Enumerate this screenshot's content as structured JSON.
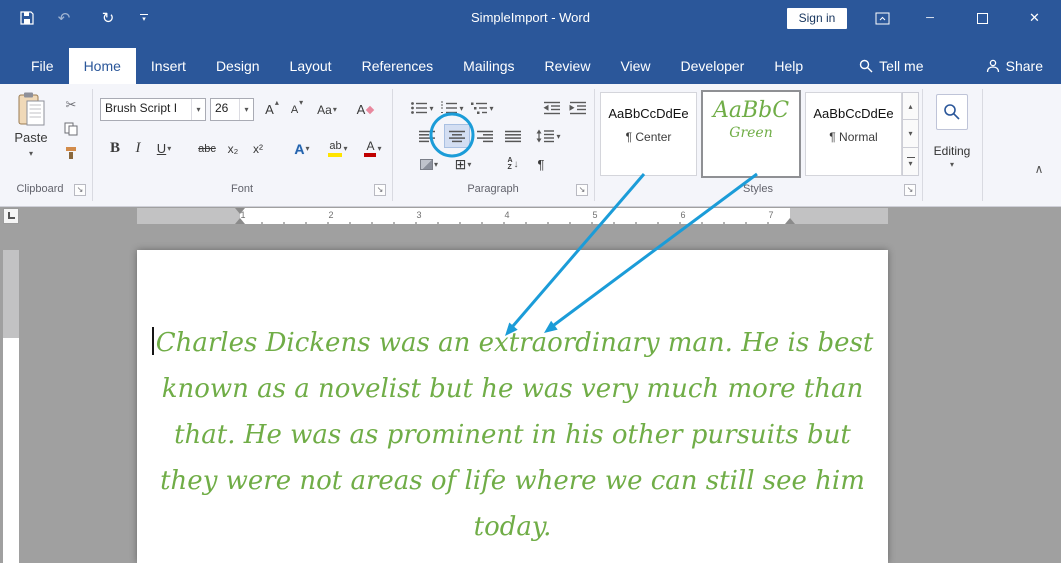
{
  "titlebar": {
    "title": "SimpleImport - Word",
    "sign_in_label": "Sign in"
  },
  "tabs": [
    {
      "label": "File"
    },
    {
      "label": "Home",
      "active": true
    },
    {
      "label": "Insert"
    },
    {
      "label": "Design"
    },
    {
      "label": "Layout"
    },
    {
      "label": "References"
    },
    {
      "label": "Mailings"
    },
    {
      "label": "Review"
    },
    {
      "label": "View"
    },
    {
      "label": "Developer"
    },
    {
      "label": "Help"
    }
  ],
  "tab_row": {
    "tell_me": "Tell me",
    "share": "Share"
  },
  "ribbon": {
    "clipboard": {
      "label": "Clipboard",
      "paste_label": "Paste"
    },
    "font": {
      "label": "Font",
      "name_value": "Brush Script I",
      "size_value": "26",
      "bold": "B",
      "italic": "I",
      "underline": "U",
      "strike": "abc",
      "subscript": "x₂",
      "superscript": "x²",
      "effects": "A",
      "highlight": "ab",
      "color": "A",
      "grow": "A",
      "shrink": "A",
      "case": "Aa",
      "clear": "A"
    },
    "paragraph": {
      "label": "Paragraph",
      "sort_a": "A",
      "sort_z": "Z"
    },
    "styles": {
      "label": "Styles",
      "items": [
        {
          "preview": "AaBbCcDdEe",
          "name": "¶ Center"
        },
        {
          "preview": "AaBbC",
          "name": "Green",
          "selected": true
        },
        {
          "preview": "AaBbCcDdEe",
          "name": "¶ Normal"
        }
      ]
    },
    "editing": {
      "label": "Editing"
    }
  },
  "ruler": {
    "numbers": [
      "1",
      "2",
      "3",
      "4",
      "5",
      "6",
      "7"
    ]
  },
  "document": {
    "lines": [
      "Charles Dickens was an extraordinary man. He is best",
      "known as a novelist but he was very much more than",
      "that. He was as prominent in his other pursuits but",
      "they were not areas of life where we can still see him",
      "today."
    ],
    "text_color": "#70ad47"
  },
  "icons": {
    "caret_down": "▾",
    "caret_up": "▴",
    "undo": "↶",
    "redo": "↻",
    "minimize": "─",
    "close": "✕",
    "scissors": "✂",
    "chevron_collapse": "∧",
    "dialog_launcher": "↘",
    "pilcrow": "¶",
    "arrow_down": "↓",
    "borders_grid": "⊞"
  },
  "colors": {
    "titlebar_blue": "#2b579a",
    "annotation_blue": "#1b9cd8",
    "text_green": "#70ad47",
    "canvas_gray": "#a0a0a0"
  }
}
